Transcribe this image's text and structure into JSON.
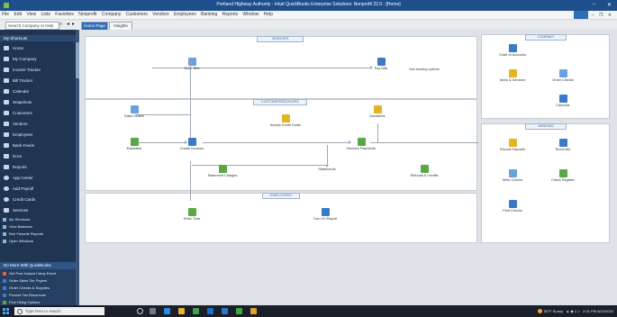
{
  "window": {
    "title": "Portland Highway Authority - Intuit QuickBooks Enterprise Solutions: Nonprofit 22.0 - [Home]",
    "minimize_label": "–",
    "close_label": "✕"
  },
  "menu": {
    "items": [
      "File",
      "Edit",
      "View",
      "Lists",
      "Favorites",
      "Nonprofit",
      "Company",
      "Customers",
      "Vendors",
      "Employees",
      "Banking",
      "Reports",
      "Window",
      "Help"
    ],
    "right_minimize": "–",
    "right_restore": "❐",
    "right_close": "✕"
  },
  "toolbar": {
    "search_placeholder": "Search Company or Help",
    "tabs": [
      {
        "label": "Home Page",
        "active": true
      },
      {
        "label": "Insights",
        "active": false
      }
    ]
  },
  "sidebar": {
    "heading": "My Shortcuts",
    "items": [
      {
        "label": "Home",
        "icon": "home-icon"
      },
      {
        "label": "My Company",
        "icon": "company-icon"
      },
      {
        "label": "Income Tracker",
        "icon": "income-tracker-icon"
      },
      {
        "label": "Bill Tracker",
        "icon": "bill-tracker-icon"
      },
      {
        "label": "Calendar",
        "icon": "calendar-icon"
      },
      {
        "label": "Snapshots",
        "icon": "snapshots-icon"
      },
      {
        "label": "Customers",
        "icon": "customers-icon"
      },
      {
        "label": "Vendors",
        "icon": "vendors-icon"
      },
      {
        "label": "Employees",
        "icon": "employees-icon"
      },
      {
        "label": "Bank Feeds",
        "icon": "bank-feeds-icon"
      },
      {
        "label": "Docs",
        "icon": "docs-icon"
      },
      {
        "label": "Reports",
        "icon": "reports-icon"
      },
      {
        "label": "App Center",
        "icon": "app-center-icon"
      },
      {
        "label": "Add Payroll",
        "icon": "add-payroll-icon"
      },
      {
        "label": "Credit Cards",
        "icon": "credit-cards-icon"
      },
      {
        "label": "Services",
        "icon": "services-icon"
      }
    ],
    "secondary_items": [
      {
        "label": "My Shortcuts"
      },
      {
        "label": "View Balances"
      },
      {
        "label": "Run Favorite Reports"
      },
      {
        "label": "Open Windows"
      }
    ],
    "bottom": {
      "heading": "Do More With QuickBooks",
      "items": [
        {
          "label": "Get Free Instant Camp Event",
          "color": "#e0662b"
        },
        {
          "label": "Order Sales Tax Payers",
          "color": "#3a7ac8"
        },
        {
          "label": "Order Checks & Supplies",
          "color": "#3a7ac8"
        },
        {
          "label": "Provide Tax Resources",
          "color": "#3a7ac8"
        },
        {
          "label": "Find Hiring Options",
          "color": "#5aa845"
        }
      ]
    }
  },
  "home": {
    "vendors": {
      "label": "VENDORS",
      "enter_bills": "Enter Bills",
      "pay_bills": "Pay Bills",
      "see_funding": "See funding options"
    },
    "customers": {
      "label": "CUSTOMERS/DONORS",
      "sales_orders": "Sales Orders",
      "accept_credit_cards": "Accept Credit Cards",
      "donations": "Donations",
      "estimates": "Estimates",
      "create_invoices": "Create Invoices",
      "receive_payments": "Receive Payments",
      "statement_charges": "Statement Charges",
      "statements": "Statements",
      "refunds_credits": "Refunds & Credits"
    },
    "employees": {
      "label": "EMPLOYEES",
      "enter_time": "Enter Time",
      "turn_on_payroll": "Turn On Payroll"
    },
    "company": {
      "label": "COMPANY",
      "chart_of_accounts": "Chart of Accounts",
      "items_services": "Items & Services",
      "order_checks": "Order Checks",
      "calendar": "Calendar"
    },
    "banking": {
      "label": "BANKING",
      "record_deposits": "Record Deposits",
      "reconcile": "Reconcile",
      "write_checks": "Write Checks",
      "check_register": "Check Register",
      "print_checks": "Print Checks"
    }
  },
  "taskbar": {
    "search_placeholder": "Type here to search",
    "weather": "82°F Sunny",
    "time": "2:01 PM",
    "date": "8/12/2022"
  }
}
